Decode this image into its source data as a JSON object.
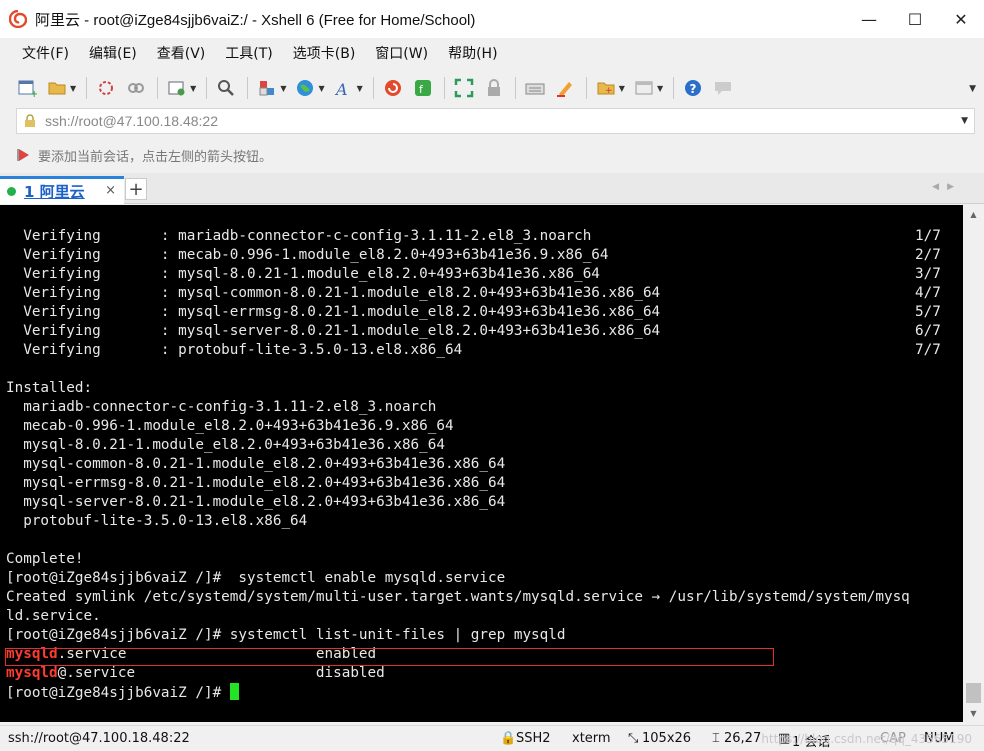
{
  "window": {
    "title": "阿里云 - root@iZge84sjjb6vaiZ:/ - Xshell 6 (Free for Home/School)",
    "controls": [
      "—",
      "☐",
      "✕"
    ]
  },
  "menu": [
    "文件(F)",
    "编辑(E)",
    "查看(V)",
    "工具(T)",
    "选项卡(B)",
    "窗口(W)",
    "帮助(H)"
  ],
  "address": {
    "value": "ssh://root@47.100.18.48:22"
  },
  "hint": {
    "text": "要添加当前会话，点击左侧的箭头按钮。"
  },
  "tab": {
    "label": "1 阿里云",
    "close": "×",
    "add": "+"
  },
  "terminal": {
    "verifying": [
      {
        "action": "Verifying",
        "pkg": "mariadb-connector-c-config-3.1.11-2.el8_3.noarch",
        "count": "1/7"
      },
      {
        "action": "Verifying",
        "pkg": "mecab-0.996-1.module_el8.2.0+493+63b41e36.9.x86_64",
        "count": "2/7"
      },
      {
        "action": "Verifying",
        "pkg": "mysql-8.0.21-1.module_el8.2.0+493+63b41e36.x86_64",
        "count": "3/7"
      },
      {
        "action": "Verifying",
        "pkg": "mysql-common-8.0.21-1.module_el8.2.0+493+63b41e36.x86_64",
        "count": "4/7"
      },
      {
        "action": "Verifying",
        "pkg": "mysql-errmsg-8.0.21-1.module_el8.2.0+493+63b41e36.x86_64",
        "count": "5/7"
      },
      {
        "action": "Verifying",
        "pkg": "mysql-server-8.0.21-1.module_el8.2.0+493+63b41e36.x86_64",
        "count": "6/7"
      },
      {
        "action": "Verifying",
        "pkg": "protobuf-lite-3.5.0-13.el8.x86_64",
        "count": "7/7"
      }
    ],
    "installed_header": "Installed:",
    "installed": [
      "mariadb-connector-c-config-3.1.11-2.el8_3.noarch",
      "mecab-0.996-1.module_el8.2.0+493+63b41e36.9.x86_64",
      "mysql-8.0.21-1.module_el8.2.0+493+63b41e36.x86_64",
      "mysql-common-8.0.21-1.module_el8.2.0+493+63b41e36.x86_64",
      "mysql-errmsg-8.0.21-1.module_el8.2.0+493+63b41e36.x86_64",
      "mysql-server-8.0.21-1.module_el8.2.0+493+63b41e36.x86_64",
      "protobuf-lite-3.5.0-13.el8.x86_64"
    ],
    "complete": "Complete!",
    "cmd1": "[root@iZge84sjjb6vaiZ /]#  systemctl enable mysqld.service",
    "symlink1": "Created symlink /etc/systemd/system/multi-user.target.wants/mysqld.service → /usr/lib/systemd/system/mysq",
    "symlink2": "ld.service.",
    "cmd2": "[root@iZge84sjjb6vaiZ /]# systemctl list-unit-files | grep mysqld",
    "unit1": {
      "match": "mysqld",
      "rest": ".service",
      "state": "enabled"
    },
    "unit2": {
      "match": "mysqld",
      "rest": "@.service",
      "state": "disabled"
    },
    "prompt": "[root@iZge84sjjb6vaiZ /]# "
  },
  "status": {
    "connection": "ssh://root@47.100.18.48:22",
    "protocol": "SSH2",
    "term": "xterm",
    "size": "105x26",
    "position": "26,27",
    "sessions": "1 会话",
    "caps": "CAP",
    "num": "NUM",
    "watermark": "https://blog.csdn.net/qq_43565190"
  },
  "colors": {
    "terminal_bg": "#000000",
    "terminal_fg": "#e8e8e8",
    "match": "#ff3b30",
    "cursor": "#23e323",
    "tab_accent": "#2a82da"
  }
}
